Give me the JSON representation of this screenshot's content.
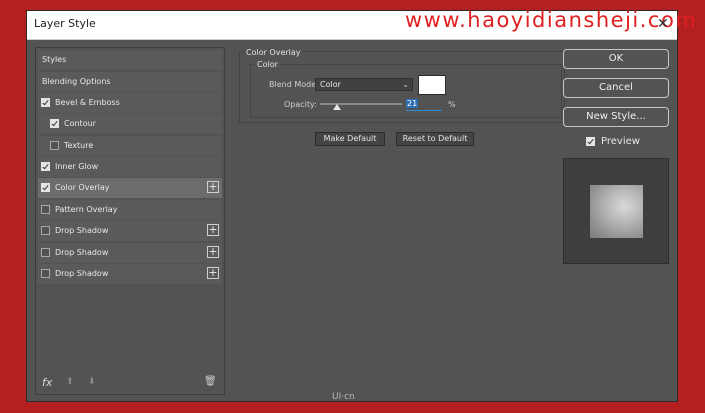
{
  "window": {
    "title": "Layer Style",
    "watermark": "www.haoyidiansheji.com",
    "close_symbol": "✕"
  },
  "left_panel": {
    "items": [
      {
        "label": "Styles",
        "checkbox": null,
        "plus": false
      },
      {
        "label": "Blending Options",
        "checkbox": null,
        "plus": false
      },
      {
        "label": "Bevel & Emboss",
        "checkbox": true,
        "plus": false
      },
      {
        "label": "Contour",
        "checkbox": true,
        "plus": false
      },
      {
        "label": "Texture",
        "checkbox": false,
        "plus": false
      },
      {
        "label": "Inner Glow",
        "checkbox": true,
        "plus": false
      },
      {
        "label": "Color Overlay",
        "checkbox": true,
        "plus": true,
        "selected": true
      },
      {
        "label": "Pattern Overlay",
        "checkbox": false,
        "plus": false
      },
      {
        "label": "Drop Shadow",
        "checkbox": false,
        "plus": true
      },
      {
        "label": "Drop Shadow",
        "checkbox": false,
        "plus": true
      },
      {
        "label": "Drop Shadow",
        "checkbox": false,
        "plus": true
      }
    ],
    "fx_label": "fx",
    "plus_symbol": "+",
    "up_symbol": "⬆",
    "down_symbol": "⬇",
    "trash_symbol": "🗑"
  },
  "overlay": {
    "group_title": "Color Overlay",
    "sub_title": "Color",
    "blend_mode_label": "Blend Mode:",
    "blend_mode_value": "Color",
    "opacity_label": "Opacity:",
    "opacity_value": "21",
    "opacity_unit": "%",
    "opacity_fraction": 0.21,
    "overlay_color": "#ffffff",
    "make_default": "Make Default",
    "reset_to_default": "Reset to Default",
    "chevron": "⌄"
  },
  "right": {
    "ok": "OK",
    "cancel": "Cancel",
    "new_style": "New Style...",
    "preview_label": "Preview",
    "preview_checked": true
  },
  "footer": {
    "logo_text": "UI·cn"
  },
  "colors": {
    "background": "#b3201f",
    "dialog": "#535353",
    "accent": "#2d6fb5"
  }
}
